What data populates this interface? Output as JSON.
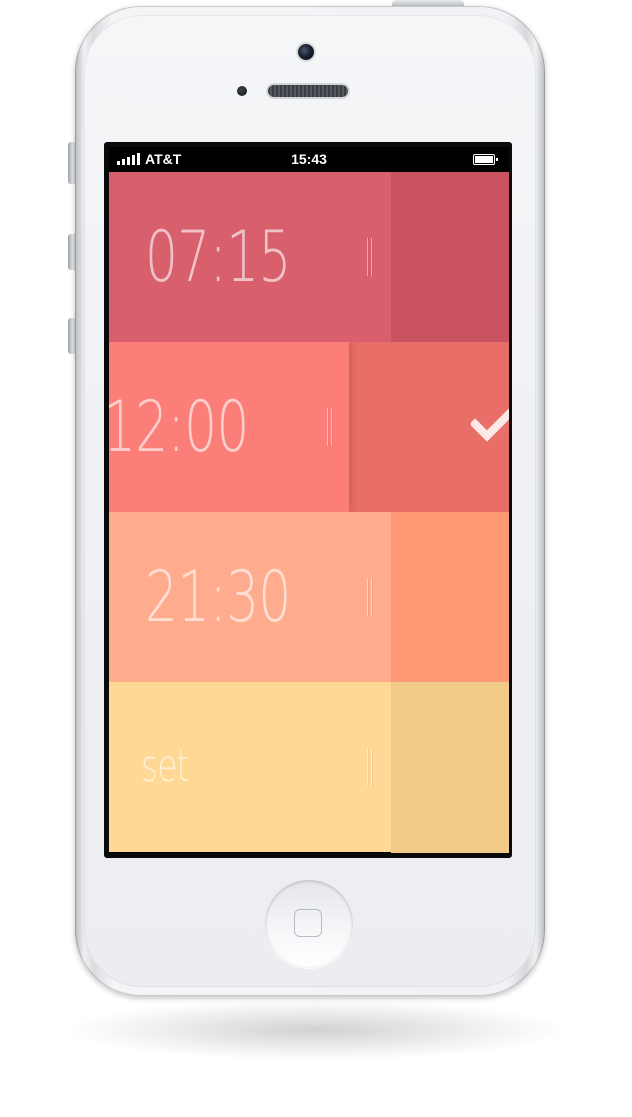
{
  "status_bar": {
    "carrier": "AT&T",
    "time": "15:43",
    "signal_icon": "signal-bars-icon",
    "battery_icon": "battery-icon"
  },
  "alarms": [
    {
      "label": "07:15",
      "main_color": "#d7606c",
      "action_color": "#c9545f",
      "state": "closed"
    },
    {
      "label": "12:00",
      "main_color": "#fb7e79",
      "action_color": "#e86e67",
      "state": "swiped-open",
      "action_icon": "checkmark-icon"
    },
    {
      "label": "21:30",
      "main_color": "#ffab8e",
      "action_color": "#ff9a76",
      "state": "closed"
    },
    {
      "label": "set",
      "main_color": "#ffd896",
      "action_color": "#f3cb88",
      "state": "closed"
    }
  ],
  "device": {
    "home_button_icon": "home-button-icon",
    "camera_icon": "front-camera-icon"
  }
}
